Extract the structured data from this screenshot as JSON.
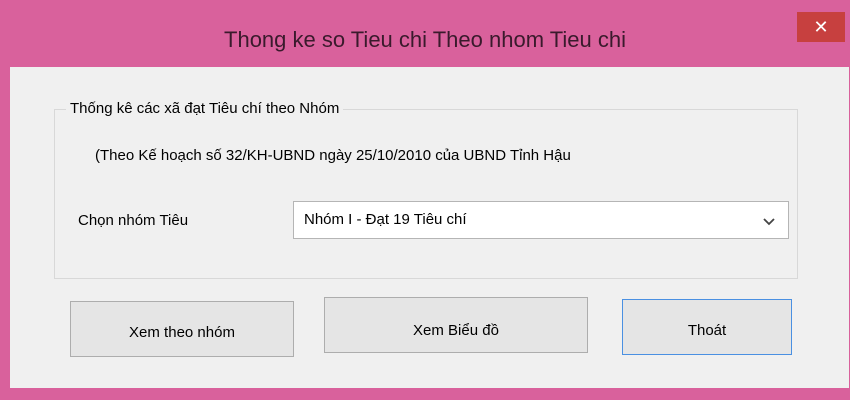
{
  "window": {
    "title": "Thong ke so Tieu chi Theo nhom Tieu chi",
    "close_label": "✕"
  },
  "group": {
    "legend": "Thống kê các xã đạt Tiêu chí theo Nhóm",
    "note": "(Theo Kế hoạch số 32/KH-UBND ngày 25/10/2010 của UBND Tỉnh Hậu"
  },
  "selector": {
    "label": "Chọn nhóm Tiêu",
    "value": "Nhóm I - Đạt 19 Tiêu chí"
  },
  "buttons": {
    "view_by_group": "Xem theo nhóm",
    "view_chart": "Xem Biểu đồ",
    "exit": "Thoát"
  },
  "colors": {
    "titlebar": "#d9619c",
    "close_button": "#c7403f",
    "client_bg": "#f0f0f0",
    "focus_border": "#4a90e2"
  },
  "icons": {
    "close": "close-icon",
    "dropdown": "chevron-down-icon"
  }
}
